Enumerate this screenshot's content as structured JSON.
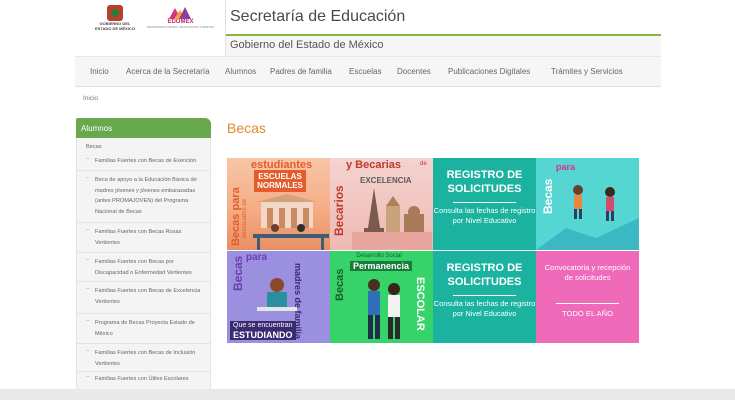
{
  "header": {
    "title": "Secretaría de Educación",
    "subtitle": "Gobierno del Estado de México",
    "seal_text_1": "GOBIERNO DEL",
    "seal_text_2": "ESTADO DE MÉXICO",
    "edomex_text": "EDOMÉX",
    "edomex_sub": "DECISIONES FIRMES, RESULTADOS FUERTES"
  },
  "nav": [
    "Inicio",
    "Acerca de la Secretaría",
    "Alumnos",
    "Padres de familia",
    "Escuelas",
    "Docentes",
    "Publicaciones Digitales",
    "Trámites y Servicios"
  ],
  "breadcrumb": "Inicio",
  "sidebar": {
    "heading": "Alumnos",
    "root": "Becas",
    "items": [
      "Familias Fuertes con Becas de Exención",
      "Beca de apoyo a la Educación Básica de madres jóvenes y jóvenes embarazadas (antes PROMAJOVEN) del Programa Nacional de Becas",
      "Familias Fuertes con Becas Rosas Vertientes",
      "Familias Fuertes con Becas por Discapacidad o Enfermedad Vertientes",
      "Familias Fuertes con Becas de Excelencia Vertientes",
      "Programa de Becas Proyecta Estado de México",
      "Familias Fuertes con Becas de Inclusión Vertientes",
      "Familias Fuertes con Útiles Escolares"
    ]
  },
  "main": {
    "title": "Becas",
    "tiles": {
      "t1": {
        "vertical": "Becas para",
        "vertical2": "destacados de",
        "top": "estudiantes",
        "banner": "ESCUELAS NORMALES"
      },
      "t2": {
        "top": "y Becarias",
        "vertical": "Becarios",
        "small": "de",
        "banner": "EXCELENCIA"
      },
      "t3": {
        "title": "REGISTRO DE SOLICITUDES",
        "body": "Consulta las fechas de registro por Nivel Educativo"
      },
      "t4": {
        "vertical": "Becas",
        "small": "para"
      },
      "t5": {
        "vertical": "Becas",
        "small": "para",
        "side": "madres de familia",
        "bottom1": "Que se encuentran",
        "bottom2": "ESTUDIANDO"
      },
      "t6": {
        "top1": "Desarrollo Social",
        "top2": "Permanencia",
        "vertical": "Becas",
        "side": "ESCOLAR"
      },
      "t7": {
        "title": "REGISTRO DE SOLICITUDES",
        "body": "Consulta las fechas de registro por Nivel Educativo"
      },
      "t8": {
        "body": "Convocatoria y recepción de solicitudes",
        "bottom": "TODO EL AÑO"
      }
    }
  }
}
